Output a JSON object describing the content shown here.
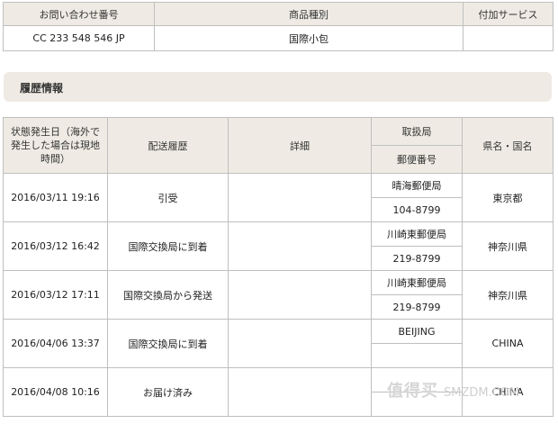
{
  "summary": {
    "headers": [
      "お問い合わせ番号",
      "商品種別",
      "付加サービス"
    ],
    "tracking_number": "CC 233 548 546 JP",
    "product_type": "国際小包",
    "added_service": ""
  },
  "section": {
    "title": "履歴情報"
  },
  "history": {
    "headers": {
      "date": "状態発生日（海外で発生した場合は現地時間）",
      "date_lines": [
        "状態発生日（海外で",
        "発生した場合は現地",
        "時間）"
      ],
      "status": "配送履歴",
      "detail": "詳細",
      "office": "取扱局",
      "postal": "郵便番号",
      "region": "県名・国名"
    },
    "rows": [
      {
        "date": "2016/03/11 19:16",
        "status": "引受",
        "detail": "",
        "office": "晴海郵便局",
        "postal": "104-8799",
        "region": "東京都"
      },
      {
        "date": "2016/03/12 16:42",
        "status": "国際交換局に到着",
        "detail": "",
        "office": "川崎東郵便局",
        "postal": "219-8799",
        "region": "神奈川県"
      },
      {
        "date": "2016/03/12 17:11",
        "status": "国際交換局から発送",
        "detail": "",
        "office": "川崎東郵便局",
        "postal": "219-8799",
        "region": "神奈川県"
      },
      {
        "date": "2016/04/06 13:37",
        "status": "国際交換局に到着",
        "detail": "",
        "office": "BEIJING",
        "postal": "",
        "region": "CHINA"
      },
      {
        "date": "2016/04/08 10:16",
        "status": "お届け済み",
        "detail": "",
        "office": "",
        "postal": "",
        "region": "CHINA"
      }
    ]
  },
  "watermark": {
    "text": "值得买",
    "sub": "SMZDM.COM"
  }
}
